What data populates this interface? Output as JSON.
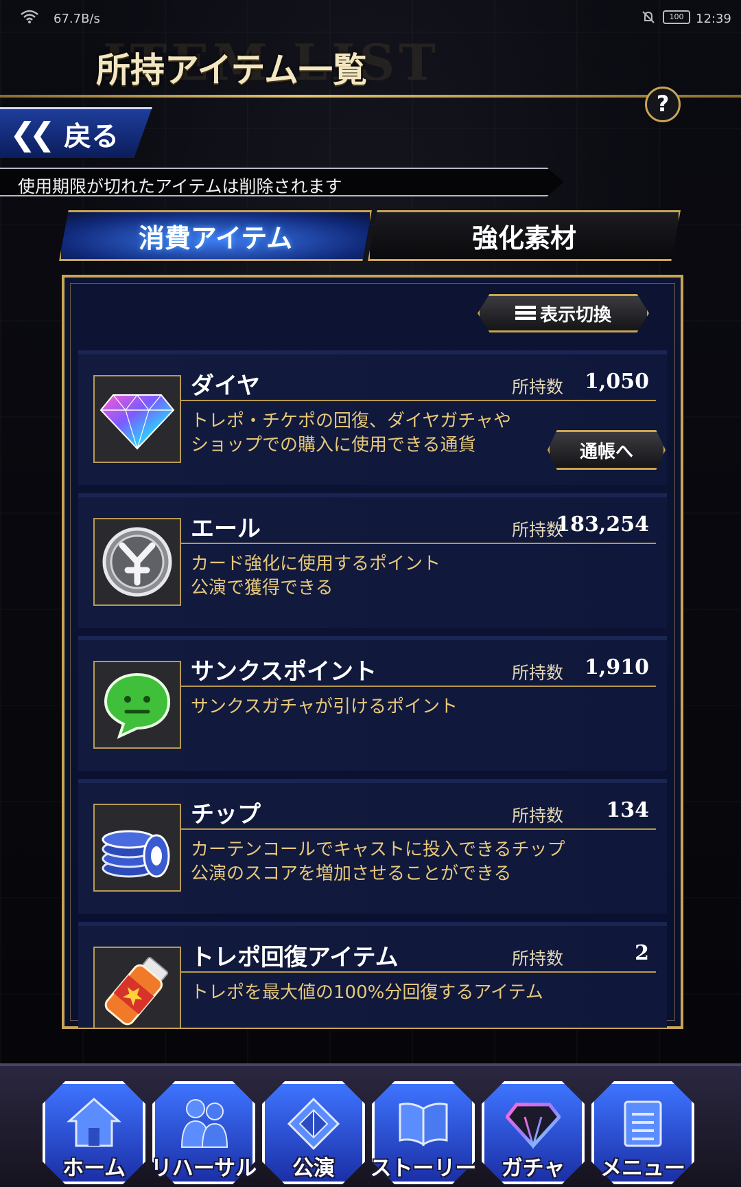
{
  "status_bar": {
    "speed": "67.7B/s",
    "battery": "100",
    "time": "12:39"
  },
  "header": {
    "deco_text": "ITEM LIST",
    "title": "所持アイテム一覧",
    "help": "?"
  },
  "back_button": {
    "label": "戻る"
  },
  "notice": "使用期限が切れたアイテムは削除されます",
  "tabs": [
    {
      "label": "消費アイテム",
      "active": true
    },
    {
      "label": "強化素材",
      "active": false
    }
  ],
  "toggle_button": {
    "label": "表示切換"
  },
  "qty_label": "所持数",
  "items": [
    {
      "name": "ダイヤ",
      "qty": "1,050",
      "desc": "トレポ・チケポの回復、ダイヤガチャや\nショップでの購入に使用できる通貨",
      "icon": "diamond-icon",
      "button": "通帳へ"
    },
    {
      "name": "エール",
      "qty": "183,254",
      "desc": "カード強化に使用するポイント\n公演で獲得できる",
      "icon": "yell-coin-icon"
    },
    {
      "name": "サンクスポイント",
      "qty": "1,910",
      "desc": "サンクスガチャが引けるポイント",
      "icon": "thanks-bubble-icon"
    },
    {
      "name": "チップ",
      "qty": "134",
      "desc": "カーテンコールでキャストに投入できるチップ\n公演のスコアを増加させることができる",
      "icon": "chip-stack-icon"
    },
    {
      "name": "トレポ回復アイテム",
      "qty": "2",
      "desc": "トレポを最大値の100%分回復するアイテム",
      "icon": "recovery-bottle-icon"
    }
  ],
  "nav": [
    {
      "label": "ホーム",
      "icon": "home-icon"
    },
    {
      "label": "リハーサル",
      "icon": "rehearsal-icon"
    },
    {
      "label": "公演",
      "icon": "performance-icon"
    },
    {
      "label": "ストーリー",
      "icon": "story-book-icon"
    },
    {
      "label": "ガチャ",
      "icon": "gacha-diamond-icon"
    },
    {
      "label": "メニュー",
      "icon": "menu-notepad-icon"
    }
  ]
}
